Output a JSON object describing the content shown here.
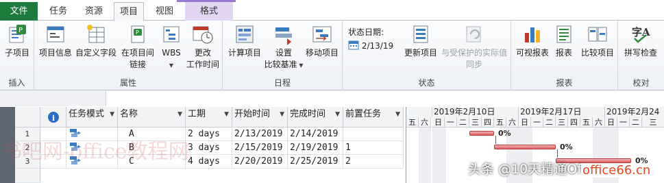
{
  "tabs": {
    "file": "文件",
    "task": "任务",
    "resource": "资源",
    "project": "项目",
    "view": "视图",
    "format": "格式"
  },
  "ribbon": {
    "insert": {
      "subproject": "子项目",
      "label": "插入"
    },
    "properties": {
      "project_info": "项目信息",
      "custom_fields": "自定义字段",
      "links_line1": "在项目间",
      "links_line2": "链接",
      "wbs": "WBS",
      "change_line1": "更改",
      "change_line2": "工作时间",
      "label": "属性"
    },
    "schedule": {
      "calculate": "计算项目",
      "baseline_line1": "设置",
      "baseline_line2": "比较基准",
      "move": "移动项目",
      "label": "日程"
    },
    "status": {
      "status_date_label": "状态日期:",
      "status_date": "2/13/19",
      "update": "更新项目",
      "sync_line1": "与受保护的实际值",
      "sync_line2": "同步",
      "label": "状态"
    },
    "reports": {
      "visual": "可视报表",
      "reports": "报表",
      "compare": "比较项目",
      "label": "报表"
    },
    "proofing": {
      "spelling": "拼写检查",
      "label": "校对"
    }
  },
  "grid": {
    "headers": {
      "mode": "任务模式",
      "name": "名称",
      "duration": "工期",
      "start": "开始时间",
      "finish": "完成时间",
      "pred": "前置任务"
    },
    "rows": [
      {
        "id": "1",
        "name": "A",
        "duration": "2 days",
        "start": "2/13/2019",
        "finish": "2/14/2019",
        "pred": ""
      },
      {
        "id": "2",
        "name": "B",
        "duration": "3 days",
        "start": "2/15/2019",
        "finish": "2/19/2019",
        "pred": "1"
      },
      {
        "id": "3",
        "name": "C",
        "duration": "4 days",
        "start": "2/20/2019",
        "finish": "2/25/2019",
        "pred": "2"
      }
    ]
  },
  "gantt": {
    "weeks": [
      "2019年2月10日",
      "2019年2月17日",
      "2019年2月24日"
    ],
    "days": [
      "五",
      "六",
      "日",
      "一",
      "二",
      "三",
      "四",
      "五",
      "六",
      "日",
      "一",
      "二",
      "三",
      "四",
      "五",
      "六",
      "日",
      "一",
      "二",
      "三"
    ],
    "percent_a": "0%",
    "percent_b": "0%",
    "percent_c": "0%"
  },
  "watermark": {
    "left": "书吧网-office教程网",
    "bottom_right": "头条 @10天精通Office",
    "site": "office66.cn"
  },
  "colors": {
    "file_tab": "#1f7a3e",
    "context_tab": "#9b79d0",
    "bar": "#d95c5c"
  }
}
